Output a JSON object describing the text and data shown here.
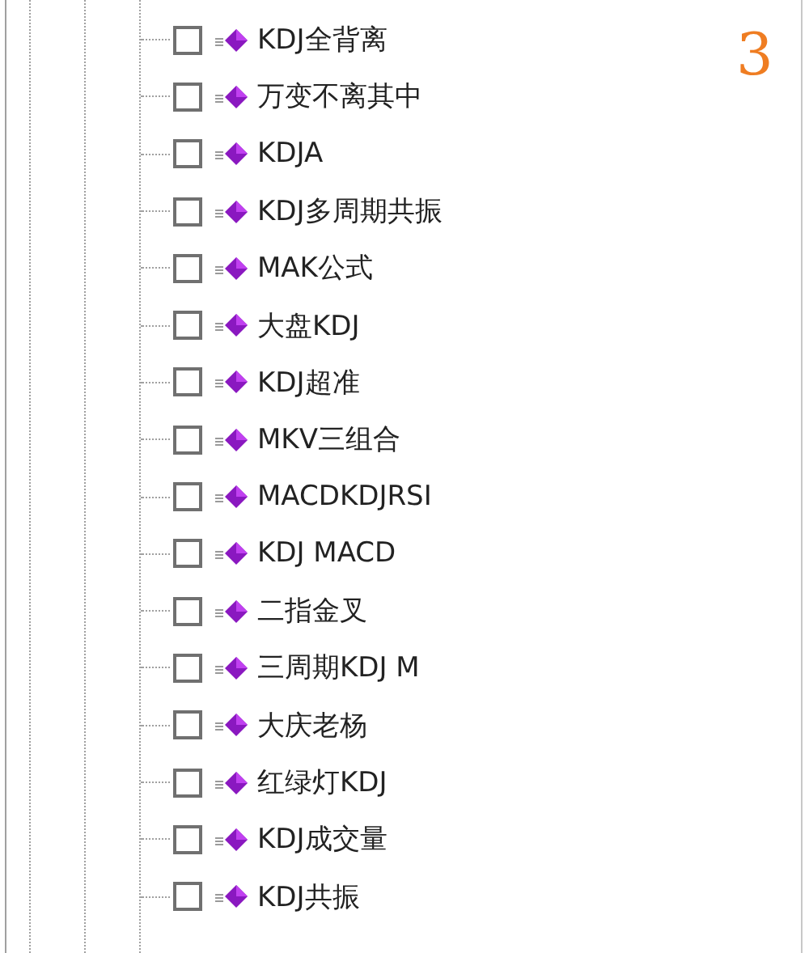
{
  "page_number": "3",
  "tree": {
    "items": [
      {
        "label": "KDJ全背离",
        "checked": false
      },
      {
        "label": "万变不离其中",
        "checked": false
      },
      {
        "label": "KDJA",
        "checked": false
      },
      {
        "label": "KDJ多周期共振",
        "checked": false
      },
      {
        "label": "MAK公式",
        "checked": false
      },
      {
        "label": "大盘KDJ",
        "checked": false
      },
      {
        "label": "KDJ超准",
        "checked": false
      },
      {
        "label": "MKV三组合",
        "checked": false
      },
      {
        "label": "MACDKDJRSI",
        "checked": false
      },
      {
        "label": "KDJ MACD",
        "checked": false
      },
      {
        "label": "二指金叉",
        "checked": false
      },
      {
        "label": "三周期KDJ M",
        "checked": false
      },
      {
        "label": "大庆老杨",
        "checked": false
      },
      {
        "label": "红绿灯KDJ",
        "checked": false
      },
      {
        "label": "KDJ成交量",
        "checked": false
      },
      {
        "label": "KDJ共振",
        "checked": false
      }
    ]
  }
}
